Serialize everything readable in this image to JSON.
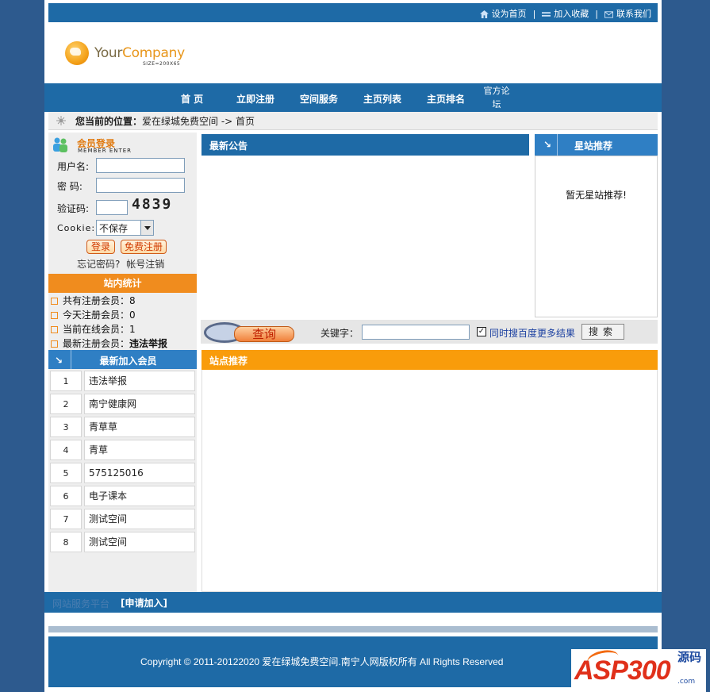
{
  "toplinks": {
    "home": "设为首页",
    "favorite": "加入收藏",
    "contact": "联系我们"
  },
  "logo": {
    "brand_a": "Your",
    "brand_b": "Company",
    "size_note": "SIZE=200X65"
  },
  "nav": {
    "items": [
      "首 页",
      "立即注册",
      "空间服务",
      "主页列表",
      "主页排名"
    ],
    "forum_l1": "官方论",
    "forum_l2": "坛"
  },
  "breadcrumb": {
    "label": "您当前的位置：",
    "site": "爱在绿城免费空间",
    "sep": " -> ",
    "current": "首页"
  },
  "login": {
    "title": "会员登录",
    "subtitle": "MEMBER ENTER",
    "username_label": "用户名:",
    "password_label": "密  码:",
    "captcha_label": "验证码:",
    "captcha_value": "4839",
    "cookie_label": "Cookie:",
    "cookie_value": "不保存",
    "login_btn": "登录",
    "register_btn": "免费注册",
    "forgot": "忘记密码?",
    "cancel": "帐号注销"
  },
  "stats": {
    "title": "站内统计",
    "rows": [
      {
        "label": "共有注册会员：",
        "value": "8"
      },
      {
        "label": "今天注册会员：",
        "value": "0"
      },
      {
        "label": "当前在线会员：",
        "value": "1"
      },
      {
        "label": "最新注册会员：",
        "value": "违法举报"
      }
    ]
  },
  "new_members": {
    "title": "最新加入会员",
    "rows": [
      {
        "n": "1",
        "name": "违法举报"
      },
      {
        "n": "2",
        "name": "南宁健康网"
      },
      {
        "n": "3",
        "name": "青草草"
      },
      {
        "n": "4",
        "name": "青草"
      },
      {
        "n": "5",
        "name": "575125016"
      },
      {
        "n": "6",
        "name": "电子课本"
      },
      {
        "n": "7",
        "name": "测试空间"
      },
      {
        "n": "8",
        "name": "测试空间"
      }
    ]
  },
  "announcement": {
    "title": "最新公告"
  },
  "star": {
    "title": "星站推荐",
    "empty": "暂无星站推荐!"
  },
  "search": {
    "query_btn": "查询",
    "keyword_label": "关键字：",
    "checkbox_label": "同时搜百度更多结果",
    "search_btn": "搜索"
  },
  "recommend": {
    "title": "站点推荐"
  },
  "friendlinks": {
    "label": "网站服务平台",
    "apply": "[申请加入]"
  },
  "footer": {
    "copyright": "Copyright © 2011-20122020 爱在绿城免费空间.南宁人网版权所有  All Rights Reserved"
  },
  "watermark": {
    "text": "ASP300",
    "cn": "源码",
    "url": ".com"
  }
}
